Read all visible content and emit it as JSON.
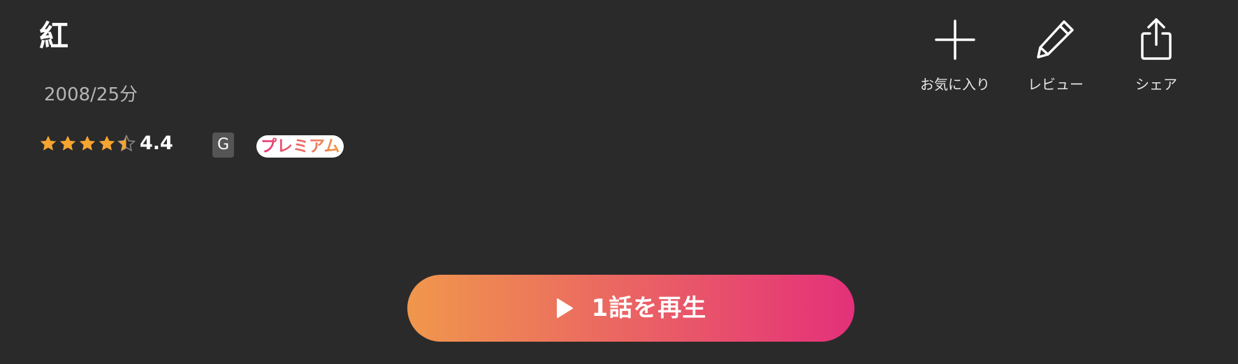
{
  "title": "紅",
  "meta": "2008/25分",
  "rating": {
    "value": "4.4",
    "stars_filled": 4.4,
    "stars_total": 5,
    "star_color": "#f6a531"
  },
  "badges": {
    "age_rating": "G",
    "premium": "プレミアム"
  },
  "actions": {
    "favorite": {
      "label": "お気に入り",
      "icon": "plus-icon"
    },
    "review": {
      "label": "レビュー",
      "icon": "pencil-icon"
    },
    "share": {
      "label": "シェア",
      "icon": "share-icon"
    }
  },
  "play_button": {
    "label": "1話を再生",
    "icon": "play-icon",
    "gradient_start": "#f0974c",
    "gradient_end": "#e4307a"
  },
  "colors": {
    "background": "#2a2a2a",
    "meta_text": "#b4b4b4"
  }
}
